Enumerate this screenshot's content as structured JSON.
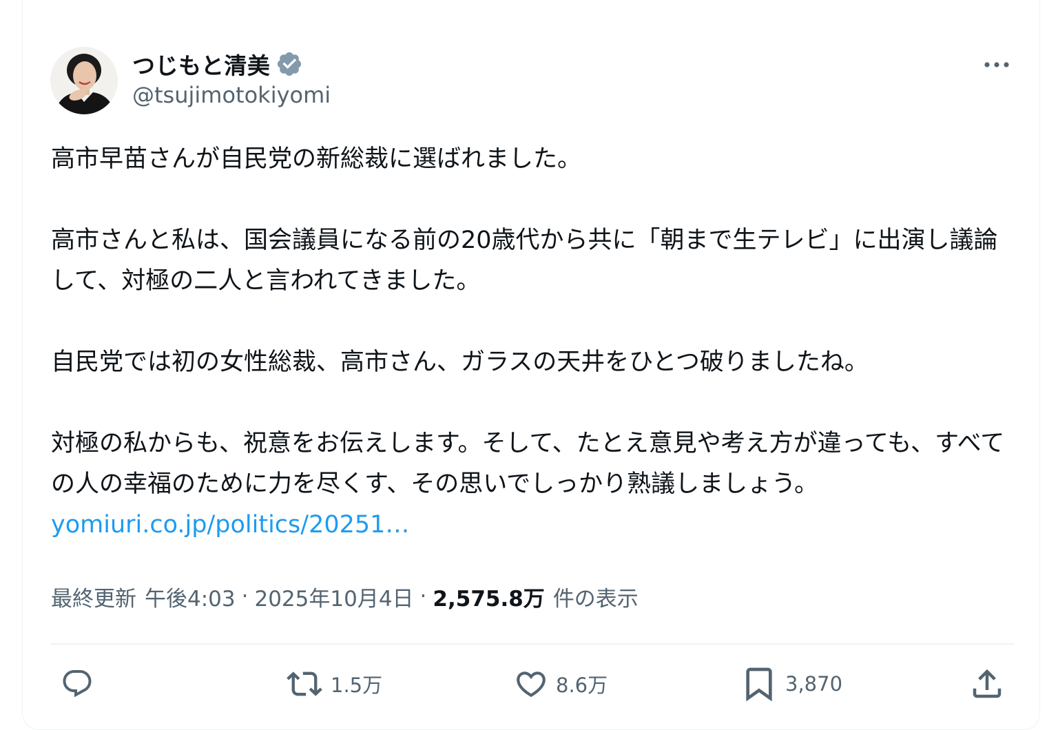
{
  "author": {
    "name": "つじもと清美",
    "handle": "@tsujimotokiyomi"
  },
  "tweet": {
    "paragraphs": [
      "高市早苗さんが自民党の新総裁に選ばれました。",
      "高市さんと私は、国会議員になる前の20歳代から共に「朝まで生テレビ」に出演し議論して、対極の二人と言われてきました。",
      "自民党では初の女性総裁、高市さん、ガラスの天井をひとつ破りましたね。"
    ],
    "last_paragraph": "対極の私からも、祝意をお伝えします。そして、たとえ意見や考え方が違っても、すべての人の幸福のために力を尽くす、その思いでしっかり熟議しましょう。",
    "link_text": "yomiuri.co.jp/politics/20251…"
  },
  "meta": {
    "updated_label": "最終更新",
    "time": "午後4:03",
    "separator": "·",
    "date": "2025年10月4日",
    "views_count": "2,575.8万",
    "views_label": "件の表示"
  },
  "actions": {
    "reply_count": "",
    "retweet_count": "1.5万",
    "like_count": "8.6万",
    "bookmark_count": "3,870"
  },
  "colors": {
    "text": "#0f1419",
    "secondary": "#536471",
    "link": "#1d9bf0",
    "verified_badge": "#829aab",
    "border": "#eff3f4"
  },
  "icons": [
    "verified-badge-icon",
    "more-icon",
    "reply-icon",
    "retweet-icon",
    "like-icon",
    "bookmark-icon",
    "share-icon"
  ]
}
